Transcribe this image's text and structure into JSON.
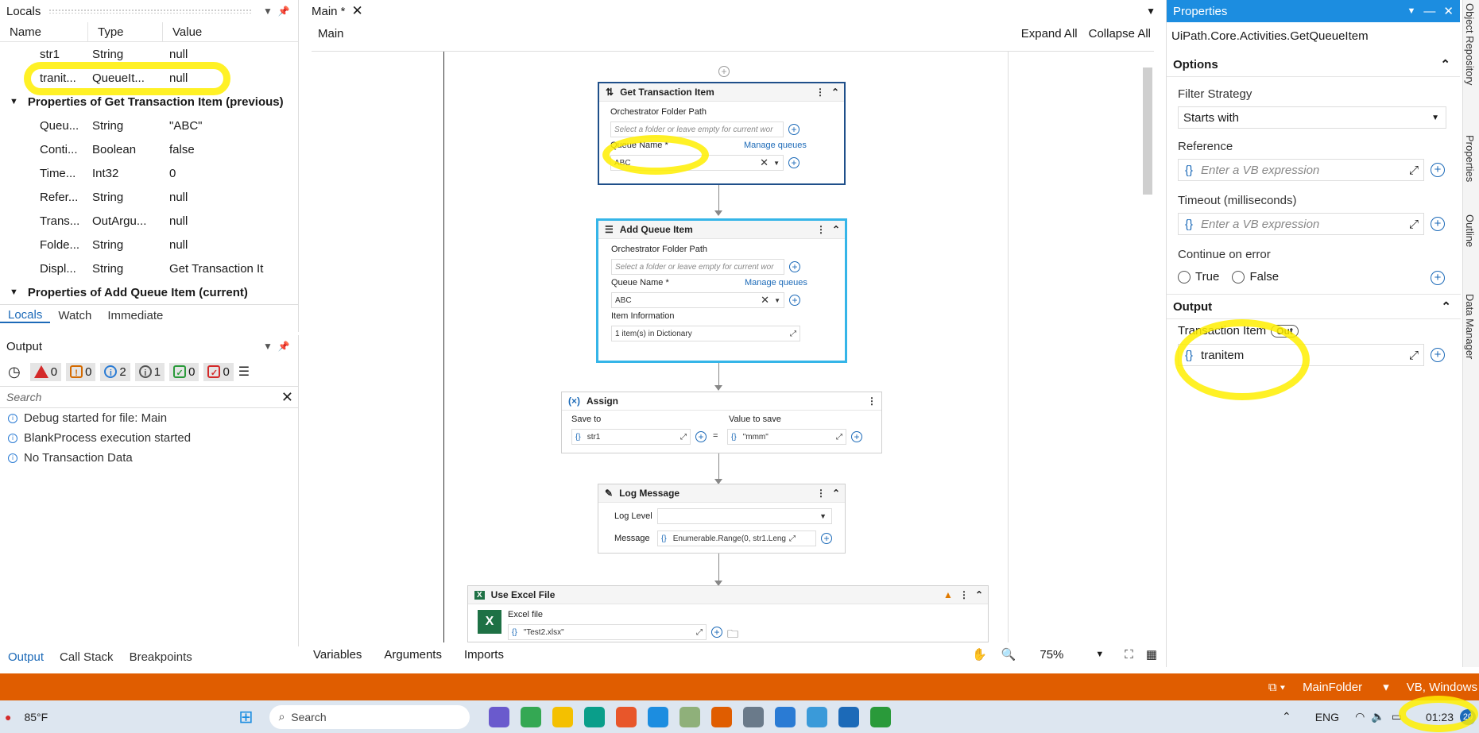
{
  "locals": {
    "title": "Locals",
    "columns": [
      "Name",
      "Type",
      "Value"
    ],
    "vars": [
      {
        "name": "str1",
        "type": "String",
        "value": "null"
      },
      {
        "name": "tranit...",
        "type": "QueueIt...",
        "value": "null"
      }
    ],
    "group1": "Properties of Get Transaction Item (previous)",
    "props": [
      {
        "name": "Queu...",
        "type": "String",
        "value": "\"ABC\""
      },
      {
        "name": "Conti...",
        "type": "Boolean",
        "value": "false"
      },
      {
        "name": "Time...",
        "type": "Int32",
        "value": "0"
      },
      {
        "name": "Refer...",
        "type": "String",
        "value": "null"
      },
      {
        "name": "Trans...",
        "type": "OutArgu...",
        "value": "null"
      },
      {
        "name": "Folde...",
        "type": "String",
        "value": "null"
      },
      {
        "name": "Displ...",
        "type": "String",
        "value": "Get Transaction It"
      }
    ],
    "group2": "Properties of Add Queue Item (current)",
    "tabs": [
      "Locals",
      "Watch",
      "Immediate"
    ]
  },
  "output": {
    "title": "Output",
    "counters": [
      "0",
      "0",
      "2",
      "1",
      "0",
      "0"
    ],
    "search_placeholder": "Search",
    "lines": [
      "Debug started for file: Main",
      "BlankProcess execution started",
      "No Transaction Data"
    ],
    "tabs": [
      "Output",
      "Call Stack",
      "Breakpoints"
    ]
  },
  "designer": {
    "tab": "Main *",
    "breadcrumb": "Main",
    "expand_all": "Expand All",
    "collapse_all": "Collapse All",
    "get_tx": {
      "title": "Get Transaction Item",
      "folder_label": "Orchestrator Folder Path",
      "folder_ph": "Select a folder or leave empty for current wor",
      "queue_label": "Queue Name *",
      "manage": "Manage queues",
      "queue_value": "ABC"
    },
    "add_queue": {
      "title": "Add Queue Item",
      "folder_label": "Orchestrator Folder Path",
      "folder_ph": "Select a folder or leave empty for current wor",
      "queue_label": "Queue Name *",
      "manage": "Manage queues",
      "queue_value": "ABC",
      "item_label": "Item Information",
      "item_value": "1 item(s) in Dictionary"
    },
    "assign": {
      "title": "Assign",
      "save_to_label": "Save to",
      "value_label": "Value to save",
      "save_to": "str1",
      "value": "\"mmm\""
    },
    "log": {
      "title": "Log Message",
      "level_label": "Log Level",
      "message_label": "Message",
      "message": "Enumerable.Range(0, str1.Leng"
    },
    "excel": {
      "title": "Use Excel File",
      "file_label": "Excel file",
      "file_value": "\"Test2.xlsx\""
    },
    "bottom_tabs": [
      "Variables",
      "Arguments",
      "Imports"
    ],
    "zoom": "75%"
  },
  "properties": {
    "title": "Properties",
    "activity": "UiPath.Core.Activities.GetQueueItem",
    "options": "Options",
    "filter_label": "Filter Strategy",
    "filter_value": "Starts with",
    "reference_label": "Reference",
    "vb_ph": "Enter a VB expression",
    "timeout_label": "Timeout (milliseconds)",
    "continue_label": "Continue on error",
    "true_label": "True",
    "false_label": "False",
    "output": "Output",
    "tx_label": "Transaction Item",
    "out_badge": "Out",
    "tx_value": "tranitem"
  },
  "rail": [
    "Object Repository",
    "Properties",
    "Outline",
    "Data Manager"
  ],
  "status": {
    "folder": "MainFolder",
    "lang": "VB, Windows"
  },
  "taskbar": {
    "weather": "85°F",
    "search": "Search",
    "lang": "ENG",
    "time": "01:23",
    "badge": "20"
  }
}
